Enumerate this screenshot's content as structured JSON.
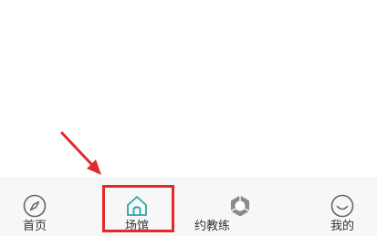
{
  "tabbar": {
    "items": [
      {
        "label": "首页",
        "icon": "compass-icon",
        "active": false
      },
      {
        "label": "场馆",
        "icon": "house-icon",
        "active": true
      },
      {
        "label": "约教练",
        "icon": "hexagon-ring-icon",
        "active": false
      },
      {
        "label": "我的",
        "icon": "smiley-icon",
        "active": false
      }
    ]
  },
  "annotation": {
    "arrow_color": "#e32a2a",
    "box_color": "#e32a2a"
  },
  "colors": {
    "icon_gray": "#666666",
    "icon_active": "#2aa7a7",
    "label_text": "#333333"
  }
}
